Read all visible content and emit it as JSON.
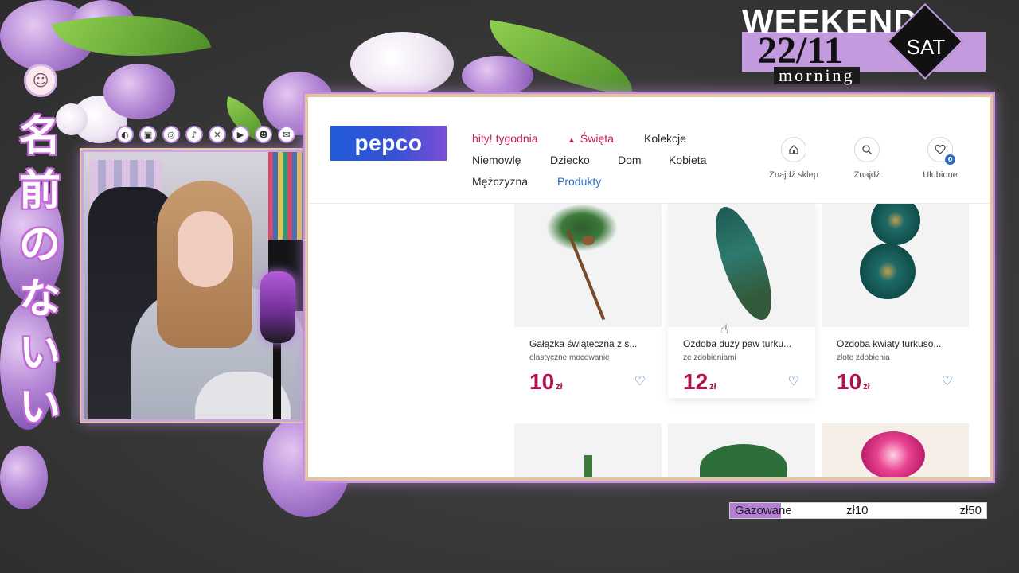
{
  "overlay": {
    "jp_title": [
      "名",
      "前",
      "の",
      "な",
      "い",
      "い"
    ],
    "social_icons": [
      "streamlabs-icon",
      "twitch-icon",
      "instagram-icon",
      "tiktok-icon",
      "x-icon",
      "youtube-icon",
      "discord-icon",
      "mail-icon"
    ],
    "weekend": {
      "word": "WEEKEND",
      "date": "22/11",
      "time_of_day": "morning",
      "day": "SAT"
    },
    "goal": {
      "label": "Gazowane",
      "current": "zł10",
      "target": "zł50",
      "progress": 0.2
    }
  },
  "site": {
    "logo": "pepco",
    "nav": {
      "row1": [
        "hity! tygodnia",
        "Święta",
        "Kolekcje"
      ],
      "row2": [
        "Niemowlę",
        "Dziecko",
        "Dom",
        "Kobieta"
      ],
      "row3": [
        "Mężczyzna",
        "Produkty"
      ]
    },
    "header_icons": [
      {
        "label": "Znajdź sklep",
        "icon": "home-icon"
      },
      {
        "label": "Znajdź",
        "icon": "search-icon"
      },
      {
        "label": "Ulubione",
        "icon": "heart-icon",
        "badge": "0"
      }
    ],
    "products": [
      {
        "title": "Gałązka świąteczna z s...",
        "subtitle": "elastyczne mocowanie",
        "price": "10",
        "currency": "zł"
      },
      {
        "title": "Ozdoba duży paw turku...",
        "subtitle": "ze zdobieniami",
        "price": "12",
        "currency": "zł"
      },
      {
        "title": "Ozdoba kwiaty turkuso...",
        "subtitle": "złote zdobienia",
        "price": "10",
        "currency": "zł"
      }
    ]
  },
  "colors": {
    "accent_purple": "#c39ade",
    "price_red": "#b0124f",
    "link_blue": "#2f6fc0"
  }
}
